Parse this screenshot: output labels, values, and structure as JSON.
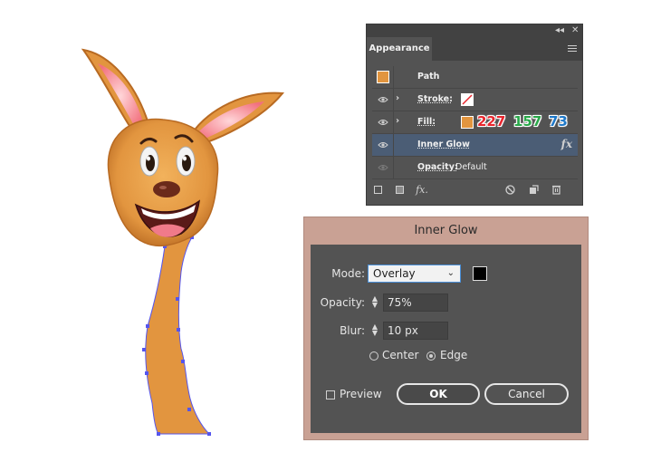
{
  "appearance": {
    "tab_label": "Appearance",
    "collapse_icon": "double-chevron-left-icon",
    "close_icon": "close-icon",
    "menu_icon": "hamburger-menu-icon",
    "path_label": "Path",
    "stroke_label": "Stroke:",
    "fill_label": "Fill:",
    "fill_color": "#e2953f",
    "fill_rgb": {
      "r": "227",
      "g": "157",
      "b": "73"
    },
    "inner_glow_label": "Inner Glow",
    "fx_label": "fx",
    "opacity_label": "Opacity:",
    "opacity_value": "Default",
    "rgb_colors": {
      "r": "#e8262e",
      "g": "#2aa84a",
      "b": "#1e78c8"
    }
  },
  "dialog": {
    "title": "Inner Glow",
    "mode_label": "Mode:",
    "mode_value": "Overlay",
    "glow_color": "#000000",
    "opacity_label": "Opacity:",
    "opacity_value": "75%",
    "blur_label": "Blur:",
    "blur_value": "10 px",
    "center_label": "Center",
    "edge_label": "Edge",
    "selected_source": "Edge",
    "preview_label": "Preview",
    "preview_checked": false,
    "ok_label": "OK",
    "cancel_label": "Cancel"
  },
  "colors": {
    "body_orange": "#e2953f",
    "selection_blue": "#5555ee",
    "dialog_title_bg": "#c9a194",
    "panel_bg": "#535353"
  }
}
